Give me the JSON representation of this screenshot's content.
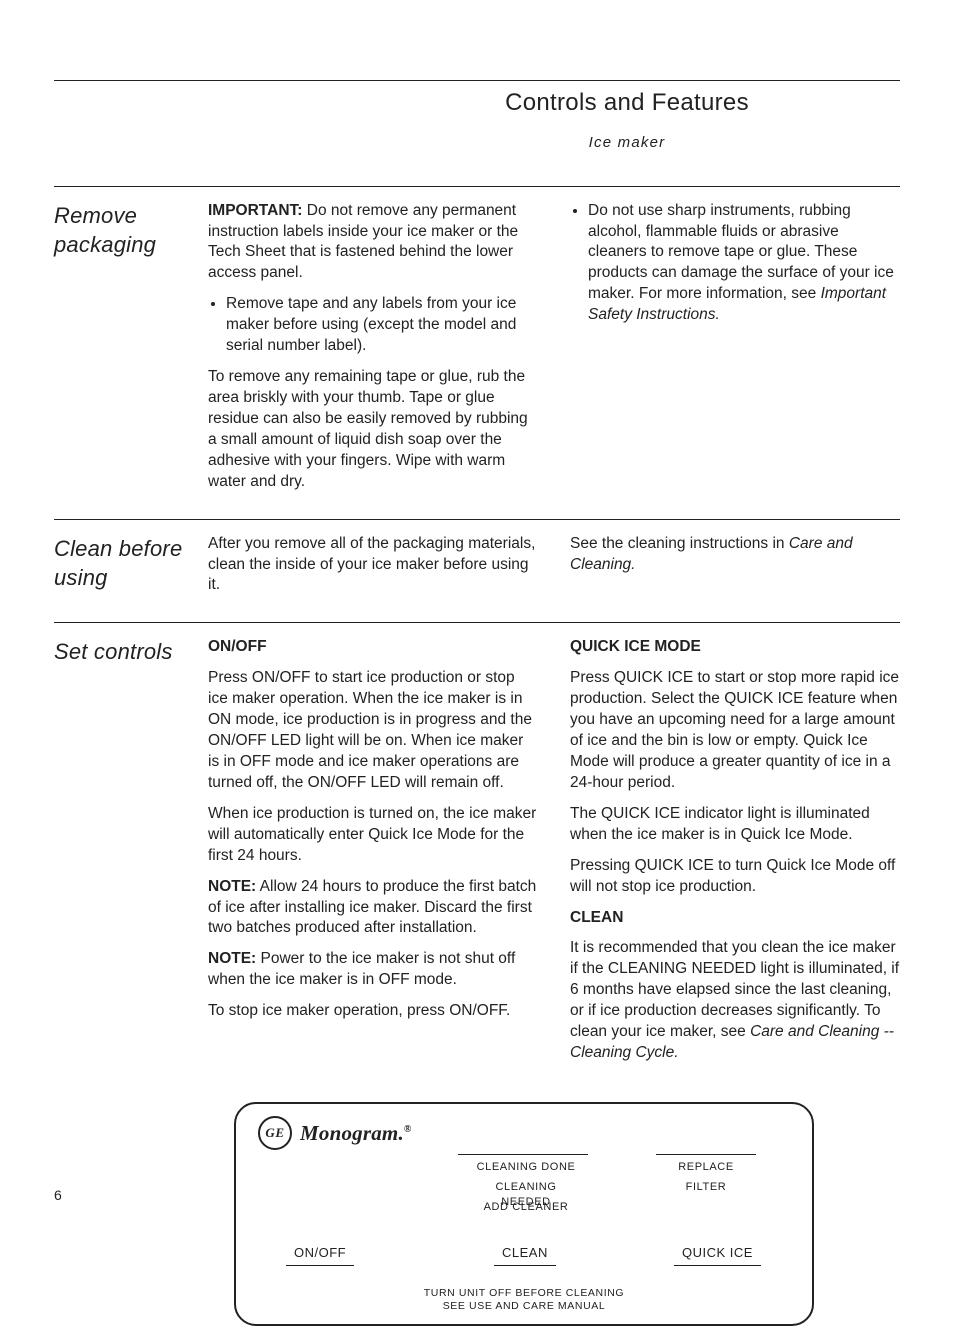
{
  "header": {
    "title": "Controls and Features",
    "subtitle": "Ice maker"
  },
  "pageNumber": "6",
  "sections": {
    "remove": {
      "heading": "Remove packaging",
      "col1": {
        "p1a": "IMPORTANT:",
        "p1b": " Do not remove any permanent instruction labels inside your ice maker or the Tech Sheet that is fastened behind the lower access panel.",
        "bullet1": "Remove tape and any labels from your ice maker before using (except the model and serial number label).",
        "p2": "To remove any remaining tape or glue, rub the area briskly with your thumb. Tape or glue residue can also be easily removed by rubbing a small amount of liquid dish soap over the adhesive with your fingers. Wipe with warm water and dry."
      },
      "col2": {
        "bullet1a": "Do not use sharp instruments, rubbing alcohol, flammable fluids or abrasive cleaners to remove tape or glue. These products can damage the surface of your ice maker. For more information, see ",
        "bullet1b": "Important Safety Instructions."
      }
    },
    "clean": {
      "heading": "Clean before using",
      "col1": {
        "p1": "After you remove all of the packaging materials, clean the inside of your ice maker before using it."
      },
      "col2": {
        "p1a": "See the cleaning instructions in ",
        "p1b": "Care and Cleaning."
      }
    },
    "set": {
      "heading": "Set controls",
      "col1": {
        "h1": "ON/OFF",
        "p1": "Press ON/OFF to start ice production or stop ice maker operation. When the ice maker is in ON mode, ice production is in progress and the ON/OFF LED light will be on. When ice maker is in OFF mode and ice maker operations are turned off, the ON/OFF LED will remain off.",
        "p2": "When ice production is turned on, the ice maker will automatically enter Quick Ice Mode for the first 24 hours.",
        "p3a": "NOTE:",
        "p3b": " Allow 24 hours to produce the first batch of ice after installing ice maker. Discard the first two batches produced after installation.",
        "p4a": "NOTE:",
        "p4b": " Power to the ice maker is not shut off when the ice maker is in OFF mode.",
        "p5": "To stop ice maker operation, press ON/OFF."
      },
      "col2": {
        "h1": "QUICK ICE MODE",
        "p1": "Press QUICK ICE to start or stop more rapid ice production. Select the QUICK ICE feature when you have an upcoming need for a large amount of ice and the bin is low or empty. Quick Ice Mode will produce a greater quantity of ice in a 24-hour period.",
        "p2": "The QUICK ICE indicator light is illuminated when the ice maker is in Quick Ice Mode.",
        "p3": "Pressing QUICK ICE to turn Quick Ice Mode off will not stop ice production.",
        "h2": "CLEAN",
        "p4a": "It is recommended that you clean the ice maker if the CLEANING NEEDED light is illuminated, if 6 months have elapsed since the last cleaning, or if ice production decreases significantly. To clean your ice maker, see ",
        "p4b": "Care and Cleaning -- Cleaning Cycle."
      }
    }
  },
  "panel": {
    "brand": "Monogram.",
    "brandMark": "GE",
    "labels": {
      "cleaningDone": "CLEANING DONE",
      "cleaningNeeded": "CLEANING NEEDED",
      "addCleaner": "ADD CLEANER",
      "replace": "REPLACE",
      "filter": "FILTER"
    },
    "buttons": {
      "onoff": "ON/OFF",
      "clean": "CLEAN",
      "quickice": "QUICK ICE"
    },
    "foot1": "TURN UNIT OFF BEFORE CLEANING",
    "foot2": "SEE USE AND CARE MANUAL"
  }
}
